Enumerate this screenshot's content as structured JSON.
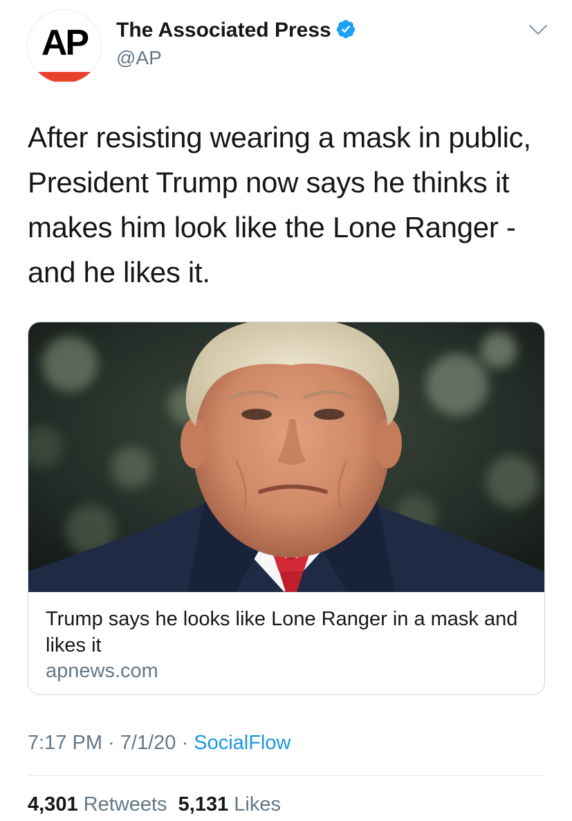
{
  "account": {
    "avatar_logo": "AP",
    "display_name": "The Associated Press",
    "handle": "@AP",
    "verified": true
  },
  "tweet": {
    "text": "After resisting wearing a mask in public, President Trump now says he thinks it makes him look like the Lone Ranger - and he likes it."
  },
  "card": {
    "title": "Trump says he looks like Lone Ranger in a mask and likes it",
    "domain": "apnews.com"
  },
  "meta": {
    "time": "7:17 PM",
    "sep1": "·",
    "date": "7/1/20",
    "sep2": "·",
    "source": "SocialFlow"
  },
  "stats": {
    "retweets_count": "4,301",
    "retweets_label": "Retweets",
    "likes_count": "5,131",
    "likes_label": "Likes"
  },
  "colors": {
    "accent": "#1b95e0",
    "muted": "#657786",
    "text": "#14171a",
    "ap_red": "#e8412c"
  },
  "icons": {
    "verified": "verified-badge-icon",
    "menu": "chevron-down-icon"
  }
}
